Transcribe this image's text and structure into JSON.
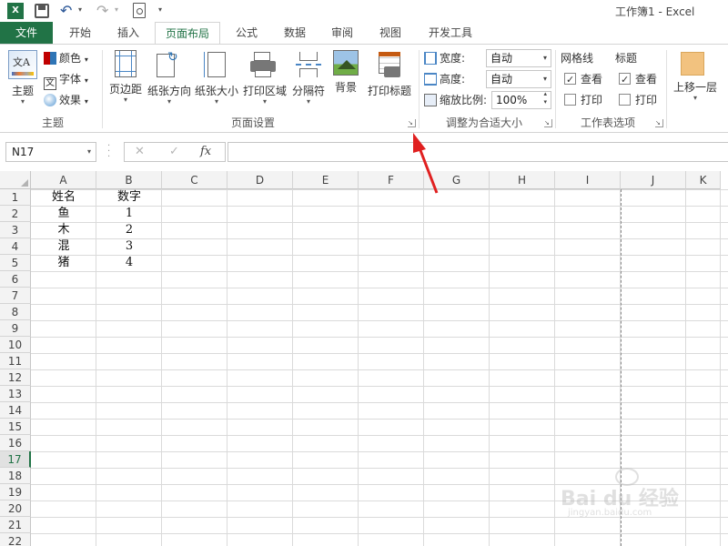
{
  "window": {
    "title": "工作簿1 - Excel"
  },
  "tabs": [
    {
      "label": "文件"
    },
    {
      "label": "开始"
    },
    {
      "label": "插入"
    },
    {
      "label": "页面布局"
    },
    {
      "label": "公式"
    },
    {
      "label": "数据"
    },
    {
      "label": "审阅"
    },
    {
      "label": "视图"
    },
    {
      "label": "开发工具"
    }
  ],
  "ribbon": {
    "theme": {
      "label": "主题",
      "colors": "颜色",
      "fonts": "字体",
      "effects": "效果",
      "group": "主题"
    },
    "page_setup": {
      "margins": "页边距",
      "orientation": "纸张方向",
      "size": "纸张大小",
      "print_area": "打印区域",
      "breaks": "分隔符",
      "background": "背景",
      "print_titles": "打印标题",
      "group": "页面设置"
    },
    "scale": {
      "width_label": "宽度:",
      "width_value": "自动",
      "height_label": "高度:",
      "height_value": "自动",
      "scale_label": "缩放比例:",
      "scale_value": "100%",
      "group": "调整为合适大小"
    },
    "sheet_options": {
      "gridlines": "网格线",
      "headings": "标题",
      "view": "查看",
      "print": "打印",
      "group": "工作表选项",
      "gridlines_view": true,
      "gridlines_print": false,
      "headings_view": true,
      "headings_print": false
    },
    "arrange": {
      "bring_forward": "上移一层"
    }
  },
  "formula_bar": {
    "name_box": "N17",
    "fx": "fx",
    "formula": ""
  },
  "sheet": {
    "columns": [
      "A",
      "B",
      "C",
      "D",
      "E",
      "F",
      "G",
      "H",
      "I",
      "J",
      "K"
    ],
    "rows": [
      "1",
      "2",
      "3",
      "4",
      "5",
      "6",
      "7",
      "8",
      "9",
      "10",
      "11",
      "12",
      "13",
      "14",
      "15",
      "16",
      "17",
      "18",
      "19",
      "20",
      "21",
      "22"
    ],
    "active_row": "17",
    "cells": {
      "A1": "姓名",
      "B1": "数字",
      "A2": "鱼",
      "B2": "1",
      "A3": "木",
      "B3": "2",
      "A4": "混",
      "B4": "3",
      "A5": "猪",
      "B5": "4"
    }
  },
  "watermark": {
    "text": "Bai du 经验",
    "url": "jingyan.baidu.com"
  },
  "colors": {
    "excel_green": "#217346",
    "annotation_arrow": "#e02020"
  }
}
